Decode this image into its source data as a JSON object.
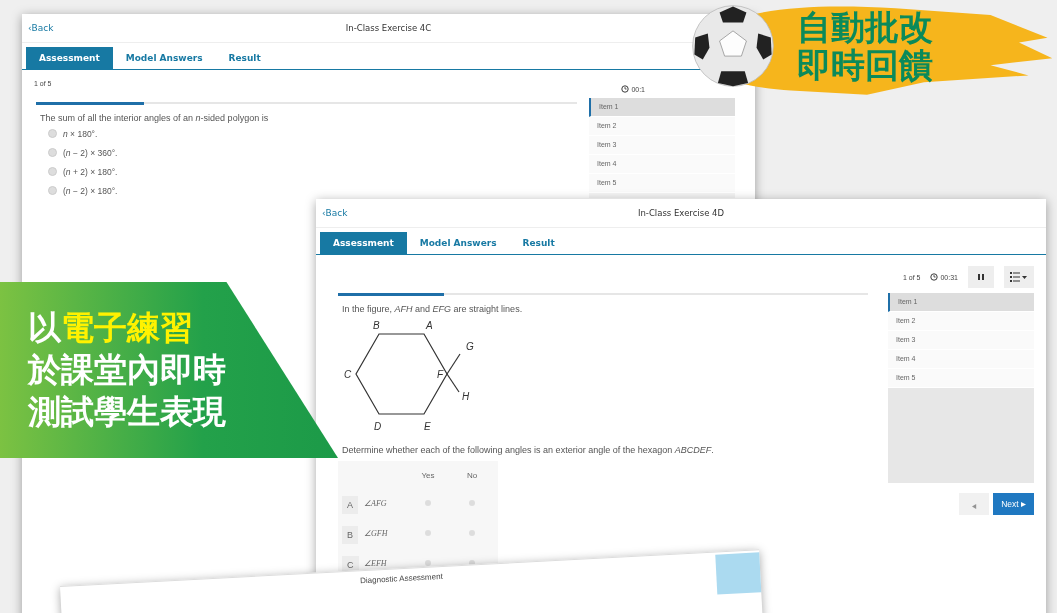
{
  "back_window": {
    "back_link": "‹Back",
    "title": "In-Class Exercise 4C",
    "tabs": [
      {
        "label": "Assessment",
        "selected": true
      },
      {
        "label": "Model Answers",
        "selected": false
      },
      {
        "label": "Result",
        "selected": false
      }
    ],
    "counter": "1 of 5",
    "timer": "00:1",
    "progress": {
      "level": 0.2
    },
    "question": "The sum of all the interior angles of an *n*-sided polygon is",
    "options": [
      {
        "text": "*n* × 180°.",
        "selected": false
      },
      {
        "text": "(*n* − 2) × 360°.",
        "selected": false
      },
      {
        "text": "(*n* + 2) × 180°.",
        "selected": false
      },
      {
        "text": "(*n* − 2) × 180°.",
        "selected": false
      }
    ],
    "items": [
      {
        "label": "Item 1",
        "selected": true
      },
      {
        "label": "Item 2",
        "selected": false
      },
      {
        "label": "Item 3",
        "selected": false
      },
      {
        "label": "Item 4",
        "selected": false
      },
      {
        "label": "Item 5",
        "selected": false
      }
    ]
  },
  "front_window": {
    "back_link": "‹Back",
    "title": "In-Class Exercise 4D",
    "tabs": [
      {
        "label": "Assessment",
        "selected": true
      },
      {
        "label": "Model Answers",
        "selected": false
      },
      {
        "label": "Result",
        "selected": false
      }
    ],
    "counter": "1 of 5",
    "timer": "00:31",
    "progress": {
      "level": 0.2
    },
    "question": "In the figure, *AFH* and *EFG* are straight lines.",
    "figure": {
      "labels": [
        "B",
        "A",
        "G",
        "C",
        "F",
        "H",
        "D",
        "E"
      ]
    },
    "prompt": "Determine whether each of the following angles is an exterior angle of the hexagon *ABCDEF*.",
    "table": {
      "columns": [
        "Yes",
        "No"
      ],
      "rows": [
        {
          "letter": "A",
          "angle": "∠AFG",
          "yes": false,
          "no": false
        },
        {
          "letter": "B",
          "angle": "∠GFH",
          "yes": false,
          "no": false
        },
        {
          "letter": "C",
          "angle": "∠EFH",
          "yes": false,
          "no": false
        }
      ]
    },
    "items": [
      {
        "label": "Item 1",
        "selected": true
      },
      {
        "label": "Item 2",
        "selected": false
      },
      {
        "label": "Item 3",
        "selected": false
      },
      {
        "label": "Item 4",
        "selected": false
      },
      {
        "label": "Item 5",
        "selected": false
      }
    ],
    "previous": {
      "disabled": true
    },
    "next": {
      "label": "Next",
      "disabled": false
    }
  },
  "bottom_window": {
    "title": "Diagnostic Assessment"
  },
  "promo_badge": {
    "lines": [
      "自動批改",
      "即時回饋"
    ]
  },
  "banner": {
    "lead": "以",
    "highlight": "電子練習",
    "lines": [
      "於課堂內即時",
      "測試學生表現"
    ]
  }
}
